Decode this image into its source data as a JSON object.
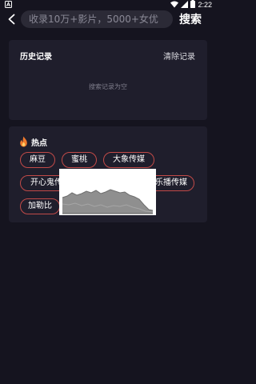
{
  "status_bar": {
    "time": "2:22",
    "icons": [
      "notification-icon",
      "wifi-icon",
      "signal-icon",
      "battery-icon"
    ]
  },
  "search": {
    "placeholder": "收录10万+影片，5000+女优",
    "button_label": "搜索",
    "back_icon": "chevron-left-icon"
  },
  "history": {
    "title": "历史记录",
    "clear_label": "清除记录",
    "empty_text": "搜索记录为空"
  },
  "hot": {
    "icon": "fire-icon",
    "title": "热点",
    "tags": [
      "麻豆",
      "蜜桃",
      "大象传媒",
      "开心鬼传",
      "乐播传媒",
      "加勒比"
    ]
  },
  "colors": {
    "background": "#15141f",
    "card": "#1f1e2c",
    "input_background": "#2b2a36",
    "tag_border": "#c14a48",
    "accent_fire": "#f07a2c"
  }
}
